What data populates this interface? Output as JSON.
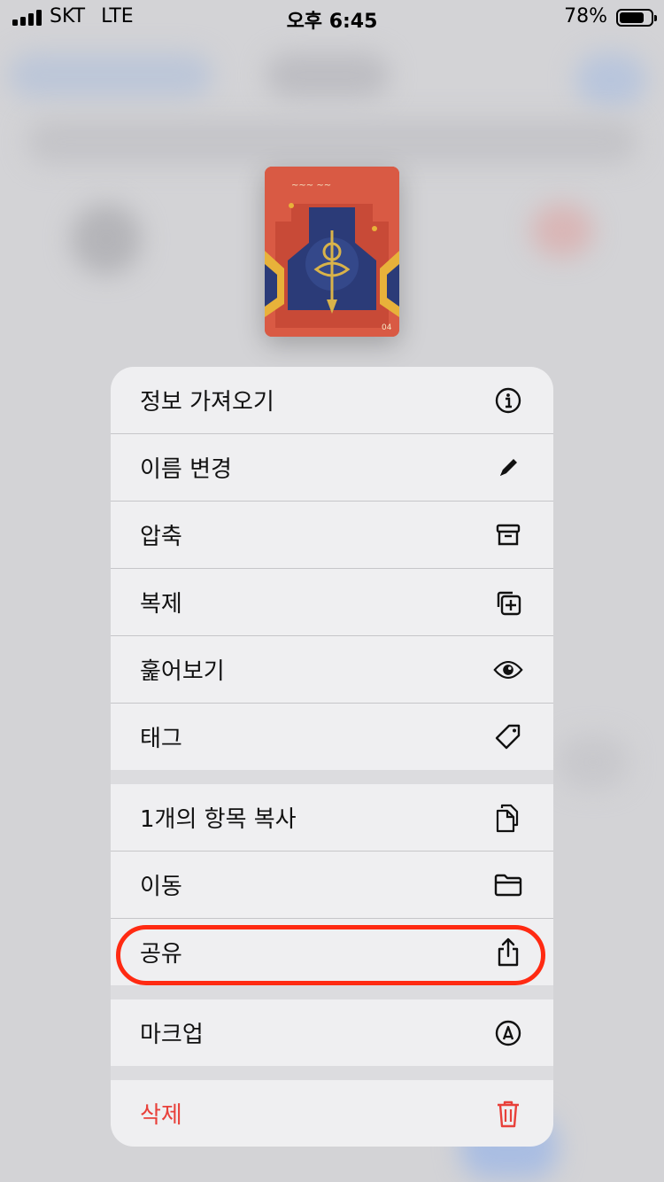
{
  "status_bar": {
    "carrier": "SKT",
    "network": "LTE",
    "time": "오후 6:45",
    "battery_percent": "78%",
    "battery_level": 0.78
  },
  "thumbnail": {
    "icon": "document-thumbnail",
    "accent_color": "#d95a44",
    "panel_color": "#2b3b78"
  },
  "menu": {
    "items": [
      {
        "label": "정보 가져오기",
        "icon": "info-circle-icon"
      },
      {
        "label": "이름 변경",
        "icon": "pencil-icon"
      },
      {
        "label": "압축",
        "icon": "archive-box-icon"
      },
      {
        "label": "복제",
        "icon": "duplicate-plus-icon"
      },
      {
        "label": "훑어보기",
        "icon": "eye-icon"
      },
      {
        "label": "태그",
        "icon": "tag-icon"
      },
      {
        "label": "1개의 항목 복사",
        "icon": "copy-documents-icon"
      },
      {
        "label": "이동",
        "icon": "folder-icon"
      },
      {
        "label": "공유",
        "icon": "share-icon"
      },
      {
        "label": "마크업",
        "icon": "markup-pen-icon"
      },
      {
        "label": "삭제",
        "icon": "trash-icon",
        "destructive_color": "#e8403a"
      }
    ]
  },
  "annotation": {
    "highlight_color": "#ff2a12",
    "target": "공유"
  }
}
